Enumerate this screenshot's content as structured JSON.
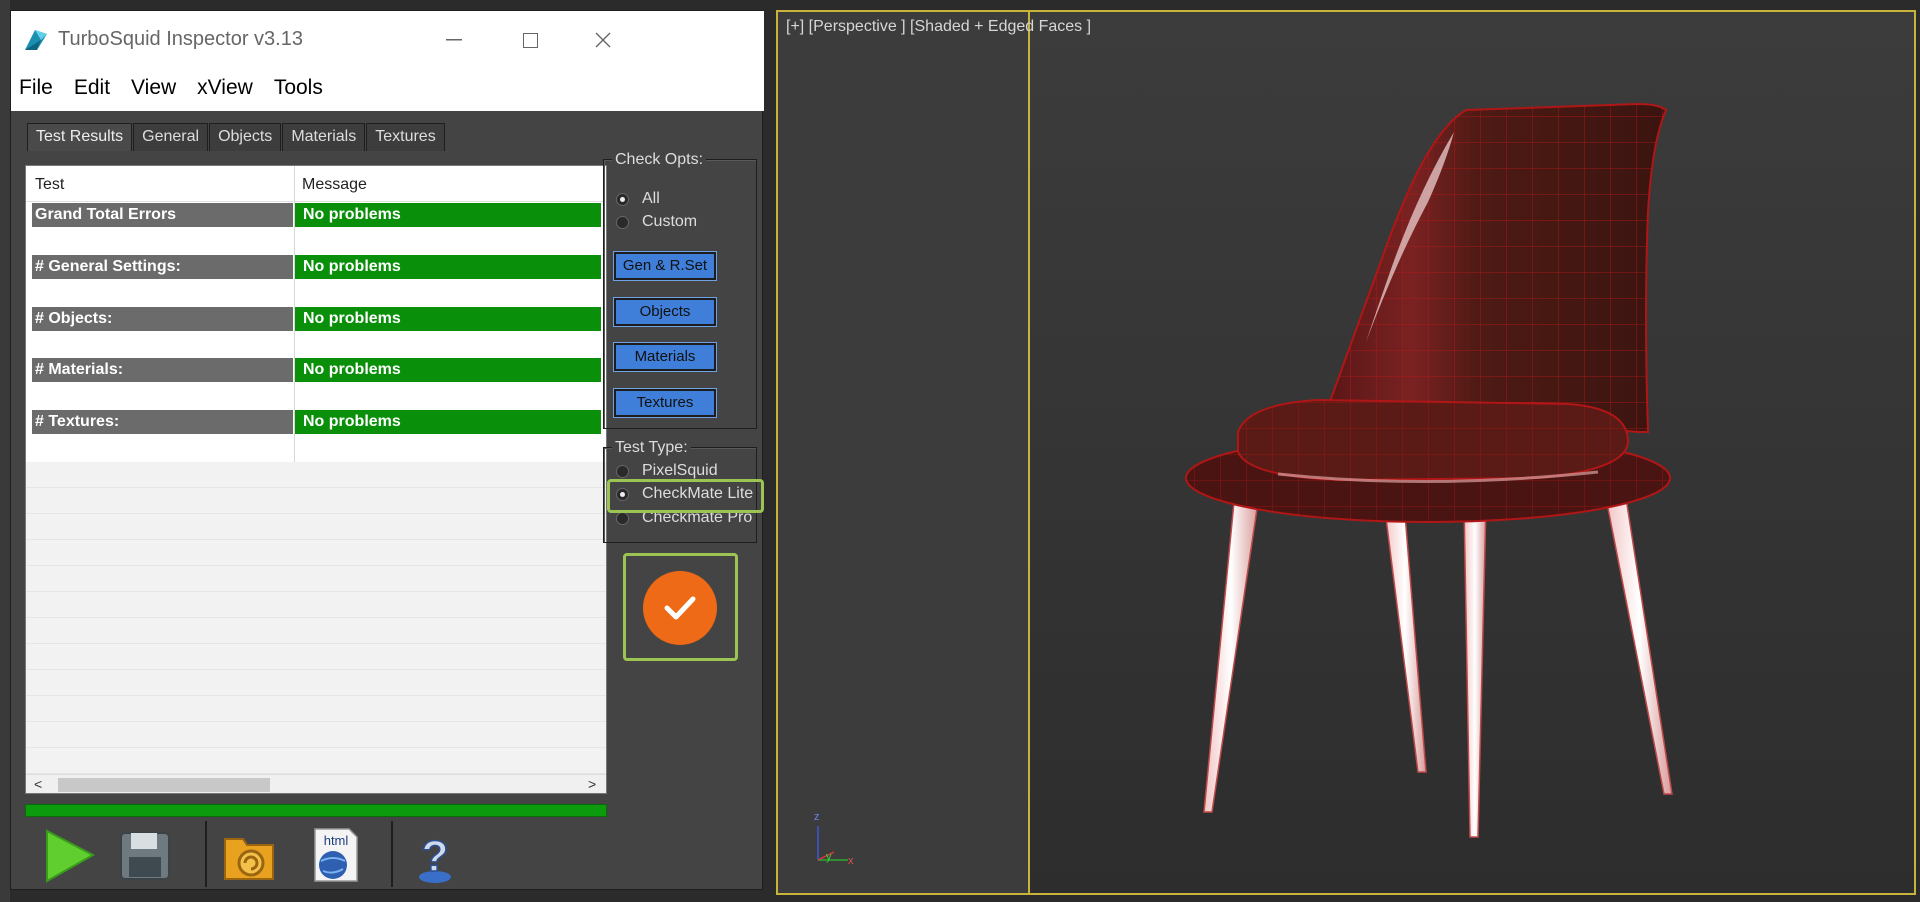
{
  "window": {
    "title": "TurboSquid Inspector v3.13",
    "minimize": "—",
    "maximize": "☐",
    "close": "✕"
  },
  "menu": [
    "File",
    "Edit",
    "View",
    "xView",
    "Tools"
  ],
  "tabs": [
    "Test Results",
    "General",
    "Objects",
    "Materials",
    "Textures"
  ],
  "grid": {
    "columns": [
      "Test",
      "Message"
    ],
    "rows": [
      {
        "test": "Grand Total Errors",
        "message": "No problems"
      },
      {
        "test": "# General Settings:",
        "message": "No problems"
      },
      {
        "test": "# Objects:",
        "message": "No problems"
      },
      {
        "test": "# Materials:",
        "message": "No problems"
      },
      {
        "test": "# Textures:",
        "message": "No problems"
      }
    ],
    "scroll_left": "<",
    "scroll_right": ">"
  },
  "check_opts": {
    "legend": "Check Opts:",
    "options": [
      "All",
      "Custom"
    ],
    "selected": "All",
    "buttons": [
      "Gen & R.Set",
      "Objects",
      "Materials",
      "Textures"
    ]
  },
  "test_type": {
    "legend": "Test Type:",
    "options": [
      "PixelSquid",
      "CheckMate Lite",
      "Checkmate Pro"
    ],
    "selected": "CheckMate Lite"
  },
  "toolbar": {
    "html_label": "html",
    "help_label": "?"
  },
  "viewport": {
    "label": "[+] [Perspective ] [Shaded + Edged Faces ]",
    "axis_z": "z",
    "axis_y": "y",
    "axis_x": "x"
  },
  "colors": {
    "ok_green": "#0a8f0a",
    "button_blue": "#3f7fd9",
    "run_orange": "#ee6a16",
    "highlight": "#9bc453",
    "viewport_border": "#c9b43b"
  }
}
